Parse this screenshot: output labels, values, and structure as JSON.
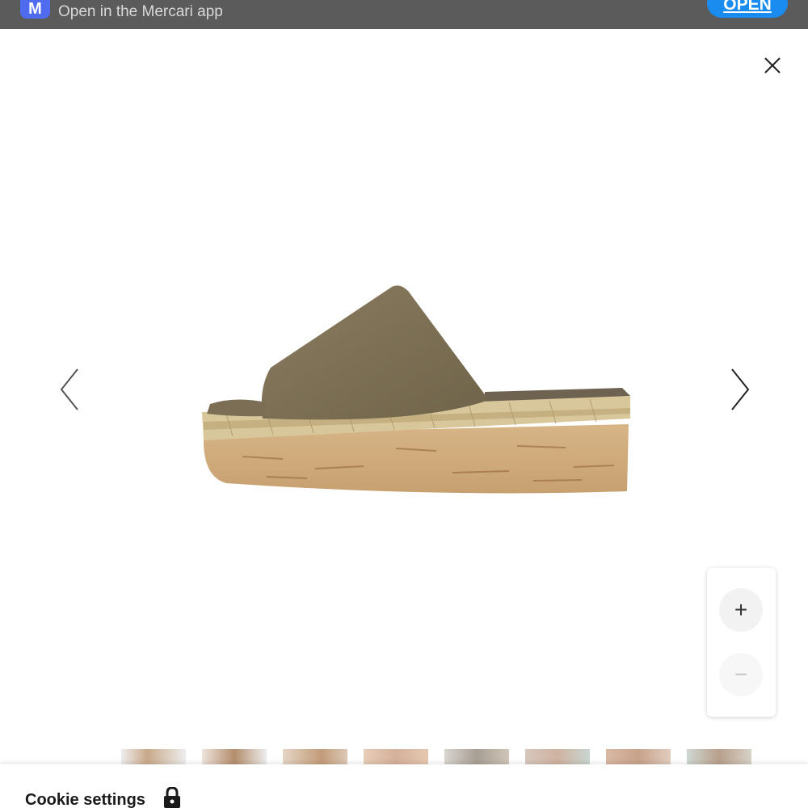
{
  "app_banner": {
    "logo_letter": "M",
    "subtitle": "Open in the Mercari app",
    "open_label": "OPEN",
    "logo_color": "#4f6cf0",
    "button_color": "#1a8cf0"
  },
  "viewer": {
    "close_icon": "close-icon",
    "prev_icon": "chevron-left-icon",
    "next_icon": "chevron-right-icon",
    "zoom": {
      "in_label": "+",
      "out_label": "−"
    },
    "thumbnail_count": 8
  },
  "cookie": {
    "title": "Cookie settings",
    "icon": "lock-icon"
  }
}
